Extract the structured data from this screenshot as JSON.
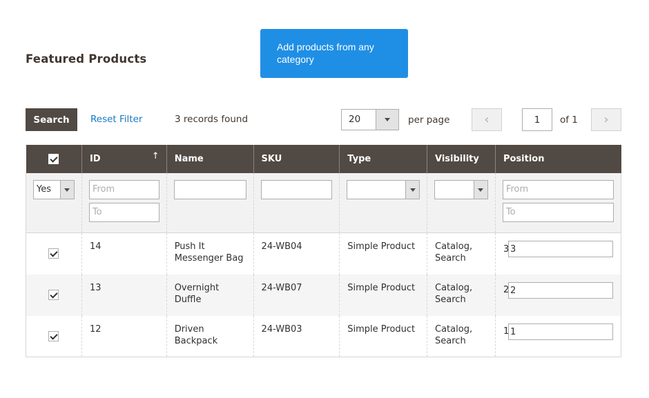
{
  "header": {
    "title": "Featured Products",
    "add_button_label": "Add products from any category"
  },
  "toolbar": {
    "search_label": "Search",
    "reset_label": "Reset Filter",
    "records_found": "3 records found",
    "per_page_value": "20",
    "per_page_label": "per page",
    "prev_icon": "‹",
    "next_icon": "›",
    "current_page": "1",
    "page_of": "of 1"
  },
  "columns": [
    {
      "key": "select",
      "label": ""
    },
    {
      "key": "id",
      "label": "ID",
      "sort": "↑"
    },
    {
      "key": "name",
      "label": "Name"
    },
    {
      "key": "sku",
      "label": "SKU"
    },
    {
      "key": "type",
      "label": "Type"
    },
    {
      "key": "visibility",
      "label": "Visibility"
    },
    {
      "key": "position",
      "label": "Position"
    }
  ],
  "filters": {
    "select_value": "Yes",
    "id_from_placeholder": "From",
    "id_to_placeholder": "To",
    "name_value": "",
    "sku_value": "",
    "type_value": "",
    "visibility_value": "",
    "position_from_placeholder": "From",
    "position_to_placeholder": "To"
  },
  "rows": [
    {
      "checked": true,
      "id": "14",
      "name": "Push It Messenger Bag",
      "sku": "24-WB04",
      "type": "Simple Product",
      "visibility": "Catalog, Search",
      "position_label": "3",
      "position": "3"
    },
    {
      "checked": true,
      "id": "13",
      "name": "Overnight Duffle",
      "sku": "24-WB07",
      "type": "Simple Product",
      "visibility": "Catalog, Search",
      "position_label": "2",
      "position": "2"
    },
    {
      "checked": true,
      "id": "12",
      "name": "Driven Backpack",
      "sku": "24-WB03",
      "type": "Simple Product",
      "visibility": "Catalog, Search",
      "position_label": "1",
      "position": "1"
    }
  ]
}
